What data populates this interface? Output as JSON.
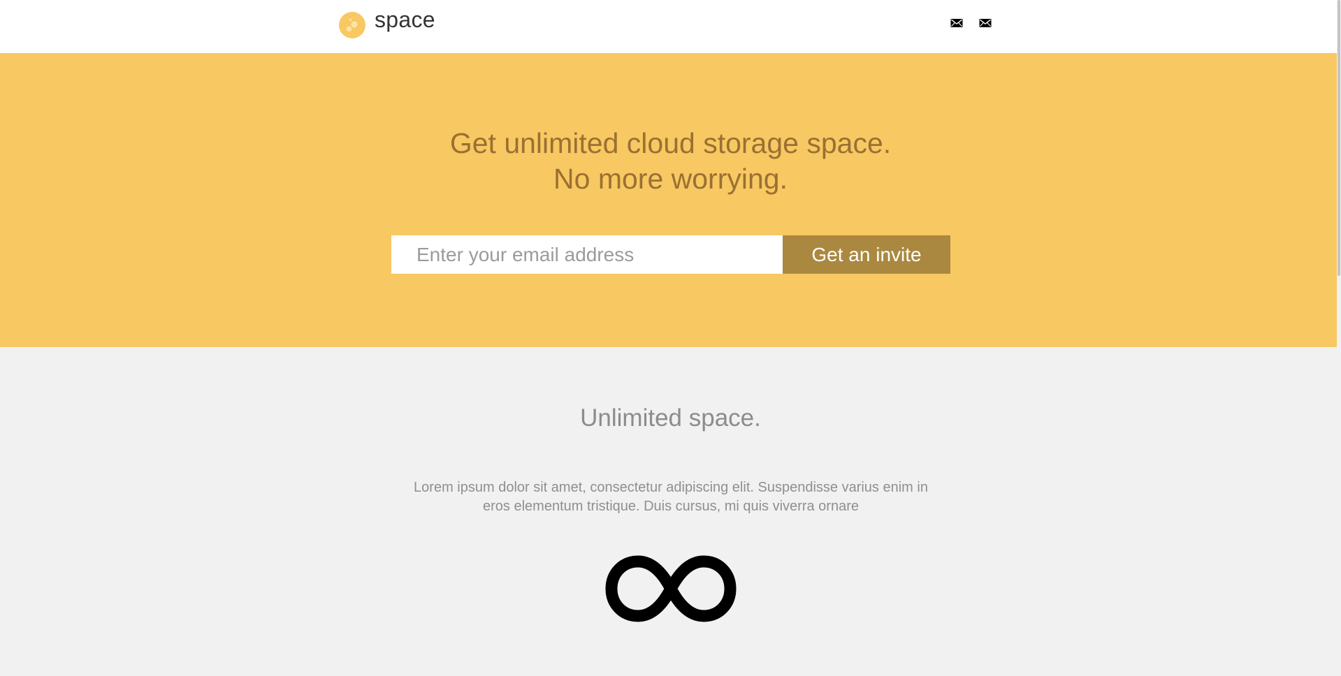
{
  "header": {
    "brand": "space",
    "icons": [
      "mail-icon",
      "mail-icon"
    ]
  },
  "hero": {
    "title_line1": "Get unlimited cloud storage space.",
    "title_line2": "No more worrying.",
    "email_placeholder": "Enter your email address",
    "email_value": "",
    "invite_label": "Get an invite"
  },
  "feature": {
    "title": "Unlimited space.",
    "text": "Lorem ipsum dolor sit amet, consectetur adipiscing elit. Suspendisse varius enim in eros elementum tristique. Duis cursus, mi quis viverra ornare",
    "icon": "infinity-icon"
  },
  "colors": {
    "header_bg": "#ffffff",
    "hero_bg": "#f8c862",
    "hero_text": "#9a7033",
    "button_bg": "#aa8840",
    "button_text": "#ffffff",
    "section_bg": "#f1f1f1",
    "section_text": "#8c8c8c"
  }
}
